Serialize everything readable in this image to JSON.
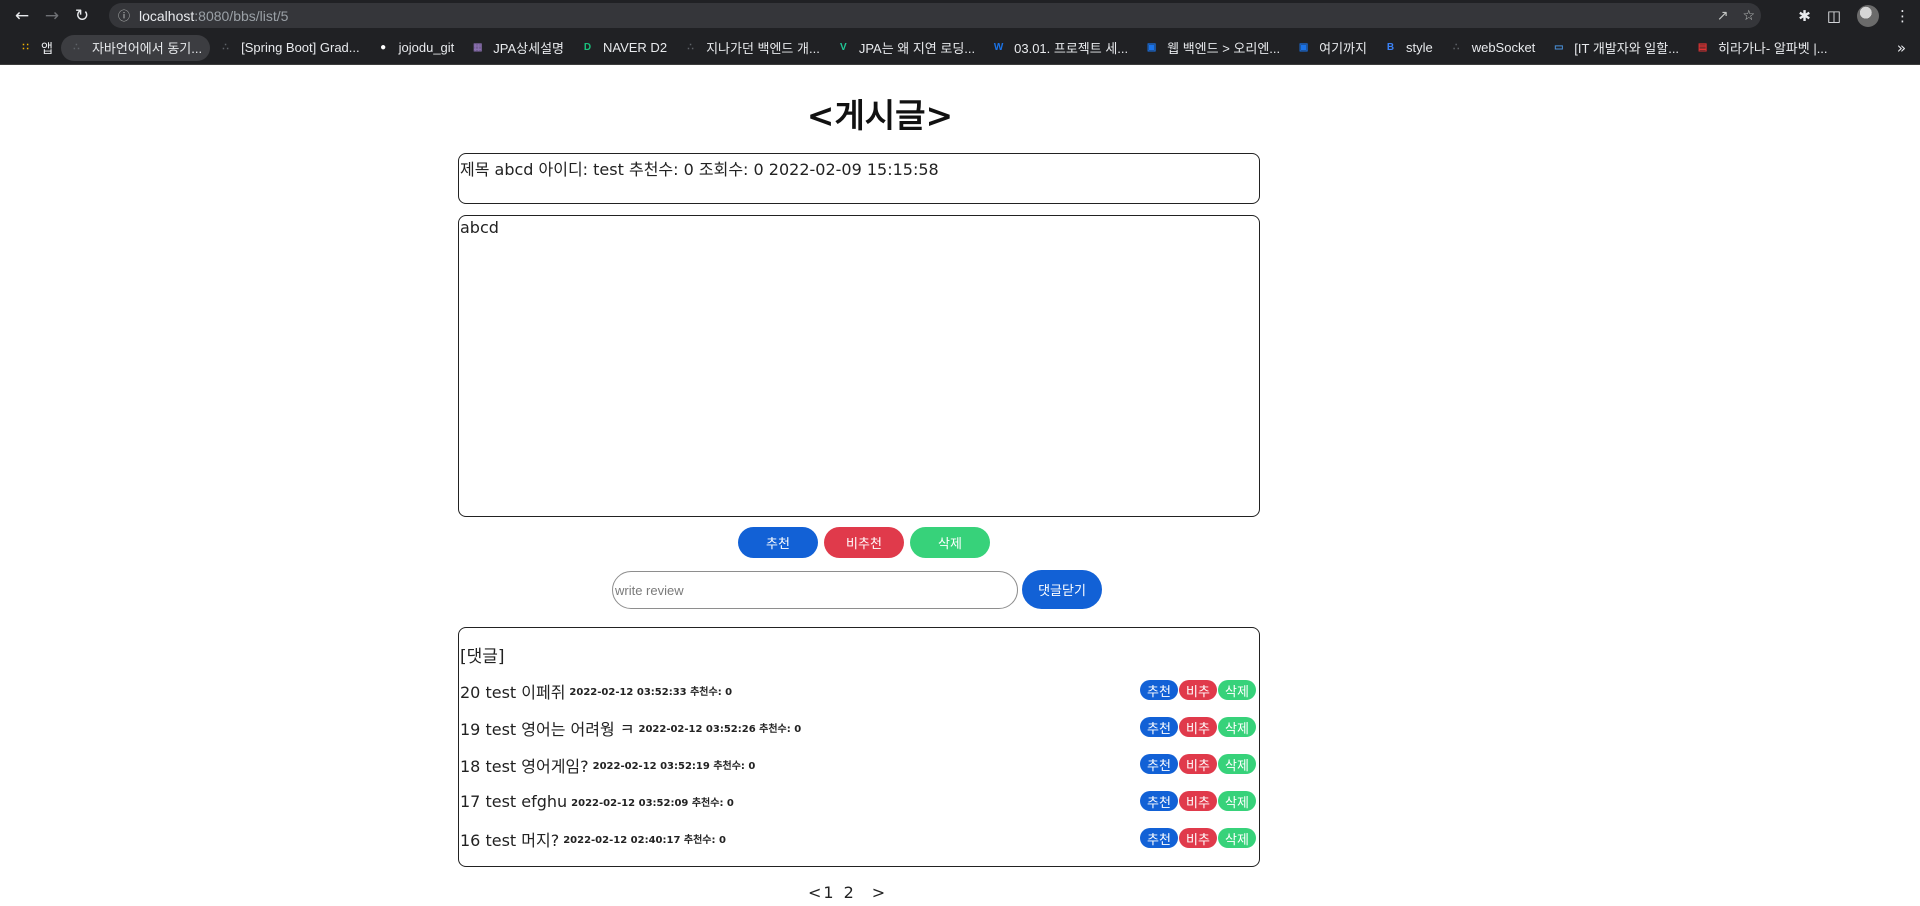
{
  "browser": {
    "url_host": "localhost",
    "url_rest": ":8080/bbs/list/5",
    "bookmarks": [
      {
        "label": "앱",
        "icon": "apps-grid-icon",
        "color": "#f4b400"
      },
      {
        "label": "자바언어에서 동기...",
        "icon": "velog-icon",
        "color": "#5f6368"
      },
      {
        "label": "[Spring Boot] Grad...",
        "icon": "velog-icon",
        "color": "#5f6368"
      },
      {
        "label": "jojodu_git",
        "icon": "github-icon",
        "color": "#ffffff"
      },
      {
        "label": "JPA상세설명",
        "icon": "bookmark-thumbnail-icon",
        "color": "#8a6fb0"
      },
      {
        "label": "NAVER D2",
        "icon": "naver-d2-icon",
        "color": "#19c37d"
      },
      {
        "label": "지나가던 백엔드 개...",
        "icon": "velog-icon",
        "color": "#5f6368"
      },
      {
        "label": "JPA는 왜 지연 로딩...",
        "icon": "v-icon",
        "color": "#20c997"
      },
      {
        "label": "03.01. 프로젝트 세...",
        "icon": "w-icon",
        "color": "#1a73e8"
      },
      {
        "label": "웹 백엔드 > 오리엔...",
        "icon": "page-icon",
        "color": "#1a73e8"
      },
      {
        "label": "여기까지",
        "icon": "page-icon",
        "color": "#1a73e8"
      },
      {
        "label": "style",
        "icon": "bootstrap-icon",
        "color": "#3b82f6"
      },
      {
        "label": "webSocket",
        "icon": "velog-icon",
        "color": "#5f6368"
      },
      {
        "label": "[IT 개발자와 일할...",
        "icon": "laptop-icon",
        "color": "#4a90d9"
      },
      {
        "label": "히라가나- 알파벳 |...",
        "icon": "chart-icon",
        "color": "#d33"
      }
    ],
    "more": "»"
  },
  "post": {
    "title": "<게시글>",
    "meta": "제목 abcd 아이디: test 추천수: 0 조회수: 0 2022-02-09 15:15:58",
    "content": "abcd",
    "buttons": {
      "recommend": "추천",
      "not_recommend": "비추천",
      "delete": "삭제"
    }
  },
  "review": {
    "placeholder": "write review",
    "close_label": "댓글닫기"
  },
  "comments": {
    "heading": "[댓글]",
    "items": [
      {
        "text": "20 test 이페쥐",
        "meta": "2022-02-12 03:52:33 추천수: 0"
      },
      {
        "text": "19 test 영어는 어려웡 ㅋ",
        "meta": "2022-02-12 03:52:26 추천수: 0"
      },
      {
        "text": "18 test 영어게임?",
        "meta": "2022-02-12 03:52:19 추천수: 0"
      },
      {
        "text": "17 test efghu",
        "meta": "2022-02-12 03:52:09 추천수: 0"
      },
      {
        "text": "16 test 머지?",
        "meta": "2022-02-12 02:40:17 추천수: 0"
      }
    ],
    "btn_recommend": "추천",
    "btn_not_recommend": "비추",
    "btn_delete": "삭제"
  },
  "pagination": {
    "prev": "<",
    "pages": [
      "1",
      "2"
    ],
    "next": ">"
  },
  "colors": {
    "recommend": "#1261d6",
    "not_recommend": "#e03a4b",
    "delete": "#37d27a"
  }
}
